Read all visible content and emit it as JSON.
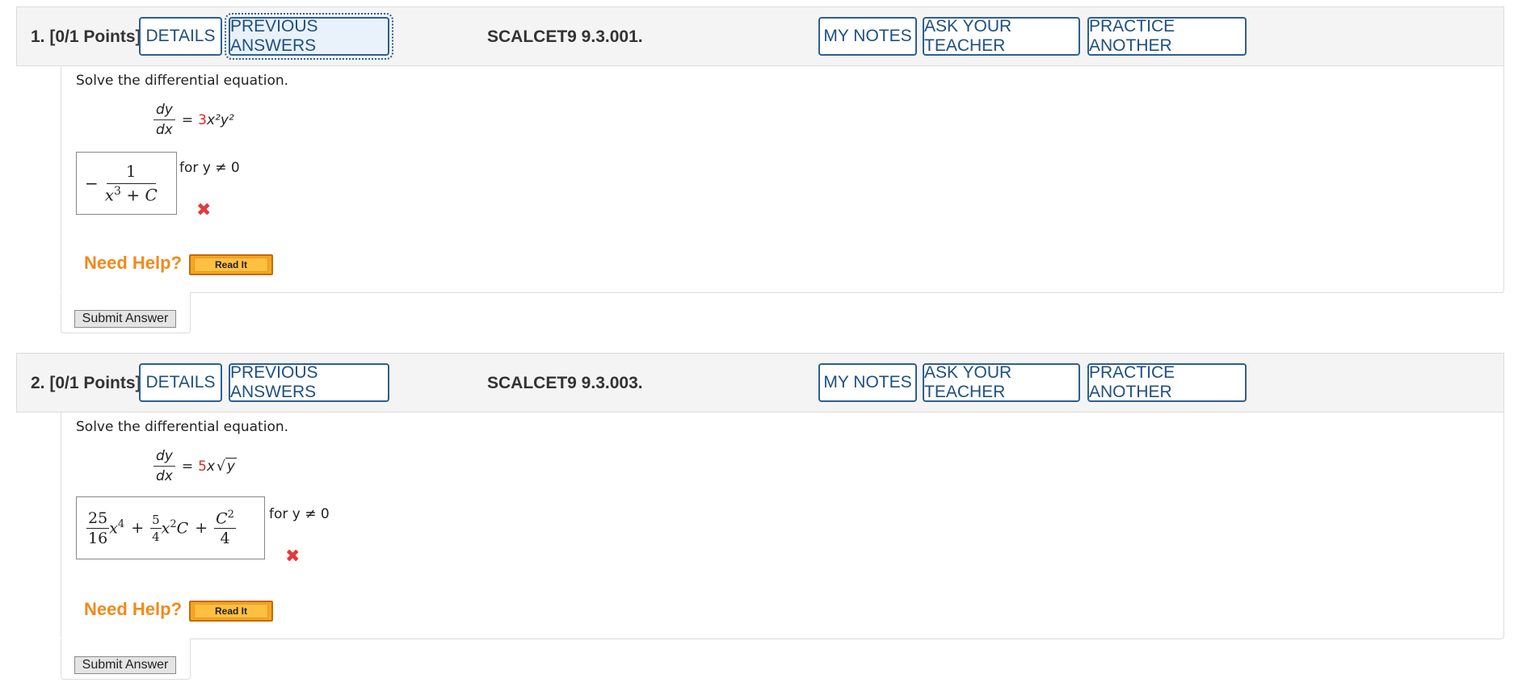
{
  "header_buttons": {
    "details": "DETAILS",
    "previous_answers": "PREVIOUS ANSWERS",
    "my_notes": "MY NOTES",
    "ask_teacher": "ASK YOUR TEACHER",
    "practice_another": "PRACTICE ANOTHER"
  },
  "questions": [
    {
      "number": "1.",
      "points": "[0/1 Points]",
      "code": "SCALCET9 9.3.001.",
      "prompt": "Solve the differential equation.",
      "lhs_num": "dy",
      "lhs_den": "dx",
      "equals": "=",
      "coefficient": "3",
      "rhs": "x²y²",
      "answer": {
        "sign": "−",
        "num": "1",
        "den_base": "x",
        "den_exp": "3",
        "den_rest": " + C"
      },
      "condition": "for y ≠ 0",
      "result": "incorrect",
      "need_help": "Need Help?",
      "read_it": "Read It",
      "submit": "Submit Answer"
    },
    {
      "number": "2.",
      "points": "[0/1 Points]",
      "code": "SCALCET9 9.3.003.",
      "prompt": "Solve the differential equation.",
      "lhs_num": "dy",
      "lhs_den": "dx",
      "equals": "=",
      "coefficient": "5",
      "rhs_var": "x",
      "rhs_sqrt": "y",
      "answer": {
        "f1_num": "25",
        "f1_den": "16",
        "t1_base": "x",
        "t1_exp": "4",
        "plus": "+",
        "f2_num": "5",
        "f2_den": "4",
        "t2_base": "x",
        "t2_exp": "2",
        "t2_rest": "C",
        "f3_num_base": "C",
        "f3_num_exp": "2",
        "f3_den": "4"
      },
      "condition": "for y ≠ 0",
      "result": "incorrect",
      "need_help": "Need Help?",
      "read_it": "Read It",
      "submit": "Submit Answer"
    }
  ],
  "colors": {
    "button_border": "#2e5f8e",
    "button_text": "#1f4f80",
    "coefficient": "#d42a2a",
    "incorrect_mark": "#e03b3b",
    "need_help": "#f08a1c",
    "read_it_bg": "#f5a623"
  },
  "icons": {
    "incorrect": "close-x-icon"
  }
}
